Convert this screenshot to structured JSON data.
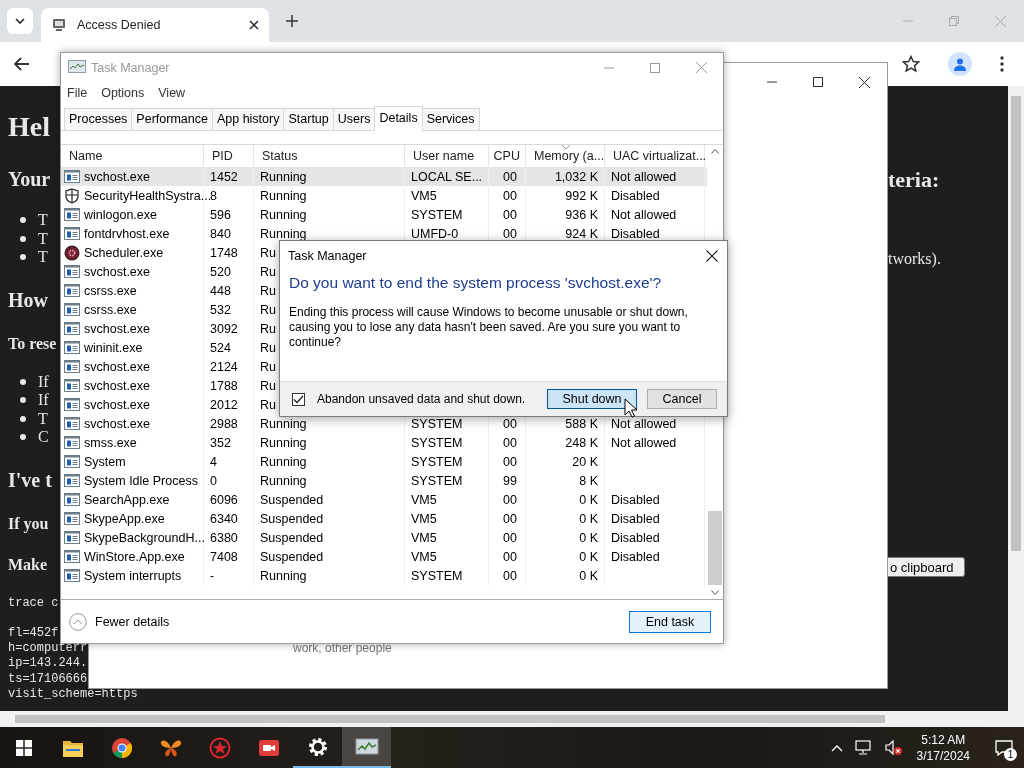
{
  "browser": {
    "tab": {
      "title": "Access Denied"
    },
    "page_left": [
      {
        "kind": "h1",
        "text": "Hel"
      },
      {
        "kind": "h2",
        "text": "Your"
      },
      {
        "kind": "li",
        "text": "T"
      },
      {
        "kind": "li",
        "text": "T"
      },
      {
        "kind": "li",
        "text": "T"
      },
      {
        "kind": "h2",
        "text": "How"
      },
      {
        "kind": "h3",
        "text": "To rese"
      },
      {
        "kind": "li",
        "text": "If"
      },
      {
        "kind": "li",
        "text": "If"
      },
      {
        "kind": "li",
        "text": "T"
      },
      {
        "kind": "li",
        "text": "C"
      },
      {
        "kind": "h2",
        "text": "I've t"
      },
      {
        "kind": "h3",
        "text": "If you"
      },
      {
        "kind": "h3",
        "text": "Make"
      },
      {
        "kind": "pre",
        "lines": [
          "trace c"
        ]
      },
      {
        "kind": "pre",
        "lines": [
          "fl=452f",
          "h=computerr",
          "ip=143.244.",
          "ts=17106666",
          "visit_scheme=https"
        ]
      }
    ],
    "page_right": [
      {
        "kind": "h2",
        "text": "teria:"
      },
      {
        "kind": "p",
        "text": "tworks)."
      },
      {
        "kind": "button",
        "text": "o clipboard"
      }
    ]
  },
  "background_window": {
    "text": "work, other people"
  },
  "task_manager": {
    "title": "Task Manager",
    "menu": [
      "File",
      "Options",
      "View"
    ],
    "tabs": [
      {
        "label": "Processes",
        "selected": false
      },
      {
        "label": "Performance",
        "selected": false
      },
      {
        "label": "App history",
        "selected": false
      },
      {
        "label": "Startup",
        "selected": false
      },
      {
        "label": "Users",
        "selected": false
      },
      {
        "label": "Details",
        "selected": true
      },
      {
        "label": "Services",
        "selected": false
      }
    ],
    "columns": [
      {
        "label": "Name",
        "sorted": false
      },
      {
        "label": "PID",
        "sorted": false
      },
      {
        "label": "Status",
        "sorted": false
      },
      {
        "label": "User name",
        "sorted": false
      },
      {
        "label": "CPU",
        "sorted": false
      },
      {
        "label": "Memory (a...",
        "sorted": true
      },
      {
        "label": "UAC virtualizat...",
        "sorted": false
      }
    ],
    "rows": [
      {
        "kind": "exe",
        "selected": true,
        "name": "svchost.exe",
        "pid": "1452",
        "status": "Running",
        "user": "LOCAL SE...",
        "cpu": "00",
        "memory": "1,032 K",
        "uac": "Not allowed"
      },
      {
        "kind": "shield",
        "selected": false,
        "name": "SecurityHealthSystra...",
        "pid": "8",
        "status": "Running",
        "user": "VM5",
        "cpu": "00",
        "memory": "992 K",
        "uac": "Disabled"
      },
      {
        "kind": "exe",
        "selected": false,
        "name": "winlogon.exe",
        "pid": "596",
        "status": "Running",
        "user": "SYSTEM",
        "cpu": "00",
        "memory": "936 K",
        "uac": "Not allowed"
      },
      {
        "kind": "exe",
        "selected": false,
        "name": "fontdrvhost.exe",
        "pid": "840",
        "status": "Running",
        "user": "UMFD-0",
        "cpu": "00",
        "memory": "924 K",
        "uac": "Disabled"
      },
      {
        "kind": "round",
        "selected": false,
        "name": "Scheduler.exe",
        "pid": "1748",
        "status": "Ru"
      },
      {
        "kind": "exe",
        "selected": false,
        "name": "svchost.exe",
        "pid": "520",
        "status": "Ru"
      },
      {
        "kind": "exe",
        "selected": false,
        "name": "csrss.exe",
        "pid": "448",
        "status": "Ru"
      },
      {
        "kind": "exe",
        "selected": false,
        "name": "csrss.exe",
        "pid": "532",
        "status": "Ru"
      },
      {
        "kind": "exe",
        "selected": false,
        "name": "svchost.exe",
        "pid": "3092",
        "status": "Ru"
      },
      {
        "kind": "exe",
        "selected": false,
        "name": "wininit.exe",
        "pid": "524",
        "status": "Ru"
      },
      {
        "kind": "exe",
        "selected": false,
        "name": "svchost.exe",
        "pid": "2124",
        "status": "Ru"
      },
      {
        "kind": "exe",
        "selected": false,
        "name": "svchost.exe",
        "pid": "1788",
        "status": "Ru"
      },
      {
        "kind": "exe",
        "selected": false,
        "name": "svchost.exe",
        "pid": "2012",
        "status": "Ru"
      },
      {
        "kind": "exe",
        "selected": false,
        "name": "svchost.exe",
        "pid": "2988",
        "status": "Running",
        "user": "SYSTEM",
        "cpu": "00",
        "memory": "588 K",
        "uac": "Not allowed"
      },
      {
        "kind": "exe",
        "selected": false,
        "name": "smss.exe",
        "pid": "352",
        "status": "Running",
        "user": "SYSTEM",
        "cpu": "00",
        "memory": "248 K",
        "uac": "Not allowed"
      },
      {
        "kind": "exe",
        "selected": false,
        "name": "System",
        "pid": "4",
        "status": "Running",
        "user": "SYSTEM",
        "cpu": "00",
        "memory": "20 K"
      },
      {
        "kind": "exe",
        "selected": false,
        "name": "System Idle Process",
        "pid": "0",
        "status": "Running",
        "user": "SYSTEM",
        "cpu": "99",
        "memory": "8 K"
      },
      {
        "kind": "exe",
        "selected": false,
        "name": "SearchApp.exe",
        "pid": "6096",
        "status": "Suspended",
        "user": "VM5",
        "cpu": "00",
        "memory": "0 K",
        "uac": "Disabled"
      },
      {
        "kind": "exe",
        "selected": false,
        "name": "SkypeApp.exe",
        "pid": "6340",
        "status": "Suspended",
        "user": "VM5",
        "cpu": "00",
        "memory": "0 K",
        "uac": "Disabled"
      },
      {
        "kind": "exe",
        "selected": false,
        "name": "SkypeBackgroundH...",
        "pid": "6380",
        "status": "Suspended",
        "user": "VM5",
        "cpu": "00",
        "memory": "0 K",
        "uac": "Disabled"
      },
      {
        "kind": "exe",
        "selected": false,
        "name": "WinStore.App.exe",
        "pid": "7408",
        "status": "Suspended",
        "user": "VM5",
        "cpu": "00",
        "memory": "0 K",
        "uac": "Disabled"
      },
      {
        "kind": "exe",
        "selected": false,
        "name": "System interrupts",
        "pid": "-",
        "status": "Running",
        "user": "SYSTEM",
        "cpu": "00",
        "memory": "0 K"
      }
    ],
    "fewer_details": "Fewer details",
    "end_task": "End task"
  },
  "dialog": {
    "title": "Task Manager",
    "heading": "Do you want to end the system process 'svchost.exe'?",
    "message": "Ending this process will cause Windows to become unusable or shut down, causing you to lose any data hasn't been saved. Are you sure you want to continue?",
    "checkbox": {
      "label": "Abandon unsaved data and shut down.",
      "checked": true
    },
    "buttons": [
      {
        "label": "Shut down",
        "focused": true
      },
      {
        "label": "Cancel",
        "focused": false
      }
    ]
  },
  "taskbar": {
    "apps": [
      {
        "selected": false,
        "running": false
      },
      {
        "selected": false,
        "running": false
      },
      {
        "selected": false,
        "running": false
      },
      {
        "selected": false,
        "running": false
      },
      {
        "selected": false,
        "running": false
      },
      {
        "selected": false,
        "running": true
      },
      {
        "selected": true,
        "running": true
      }
    ],
    "time": "5:12 AM",
    "date": "3/17/2024",
    "notifications": "1"
  }
}
